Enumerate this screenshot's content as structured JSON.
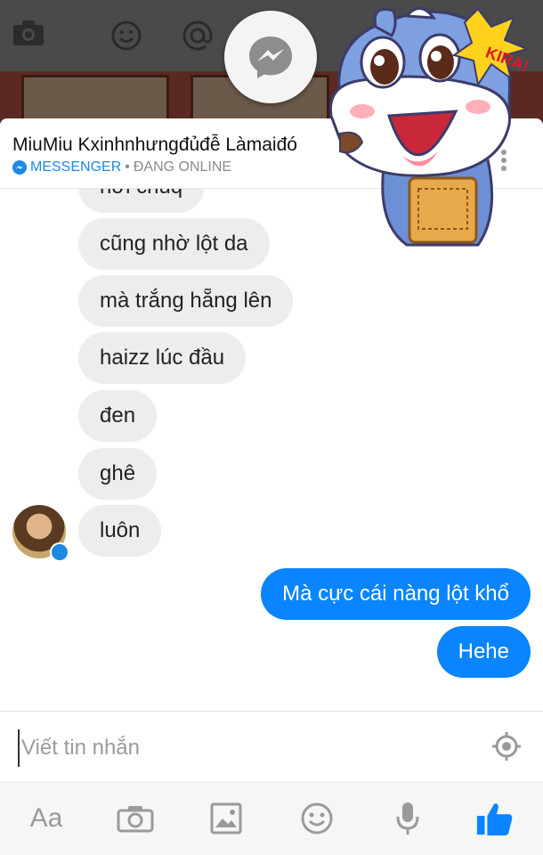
{
  "launcher": {
    "icon": "messenger-icon"
  },
  "background_toolbar": {
    "icons": [
      "camera-icon",
      "mood-icon",
      "at-icon"
    ]
  },
  "chat": {
    "contact_name": "MiuMiu Kxinhnhưngđủđễ Làmaiđó",
    "source_label": "MESSENGER",
    "separator": "•",
    "status": "ĐANG ONLINE",
    "partial_message": "hơi chúq",
    "received_messages": [
      "cũng nhờ lột da",
      "mà trắng hẵng lên",
      "haizz lúc đầu",
      "đen",
      "ghê",
      "luôn"
    ],
    "sent_messages": [
      "Mà cực cái nàng lột khổ",
      "Hehe"
    ]
  },
  "composer": {
    "placeholder": "Viết tin nhắn",
    "location_icon": "location-target-icon"
  },
  "toolbar": {
    "text_button": "Aa",
    "icons": [
      "camera-icon",
      "gallery-icon",
      "emoji-icon",
      "microphone-icon",
      "like-icon"
    ]
  },
  "sticker": {
    "text": "KIRA!"
  },
  "colors": {
    "accent": "#0a84ff",
    "received_bubble": "#eceded",
    "brand_blue": "#1e88e5"
  }
}
